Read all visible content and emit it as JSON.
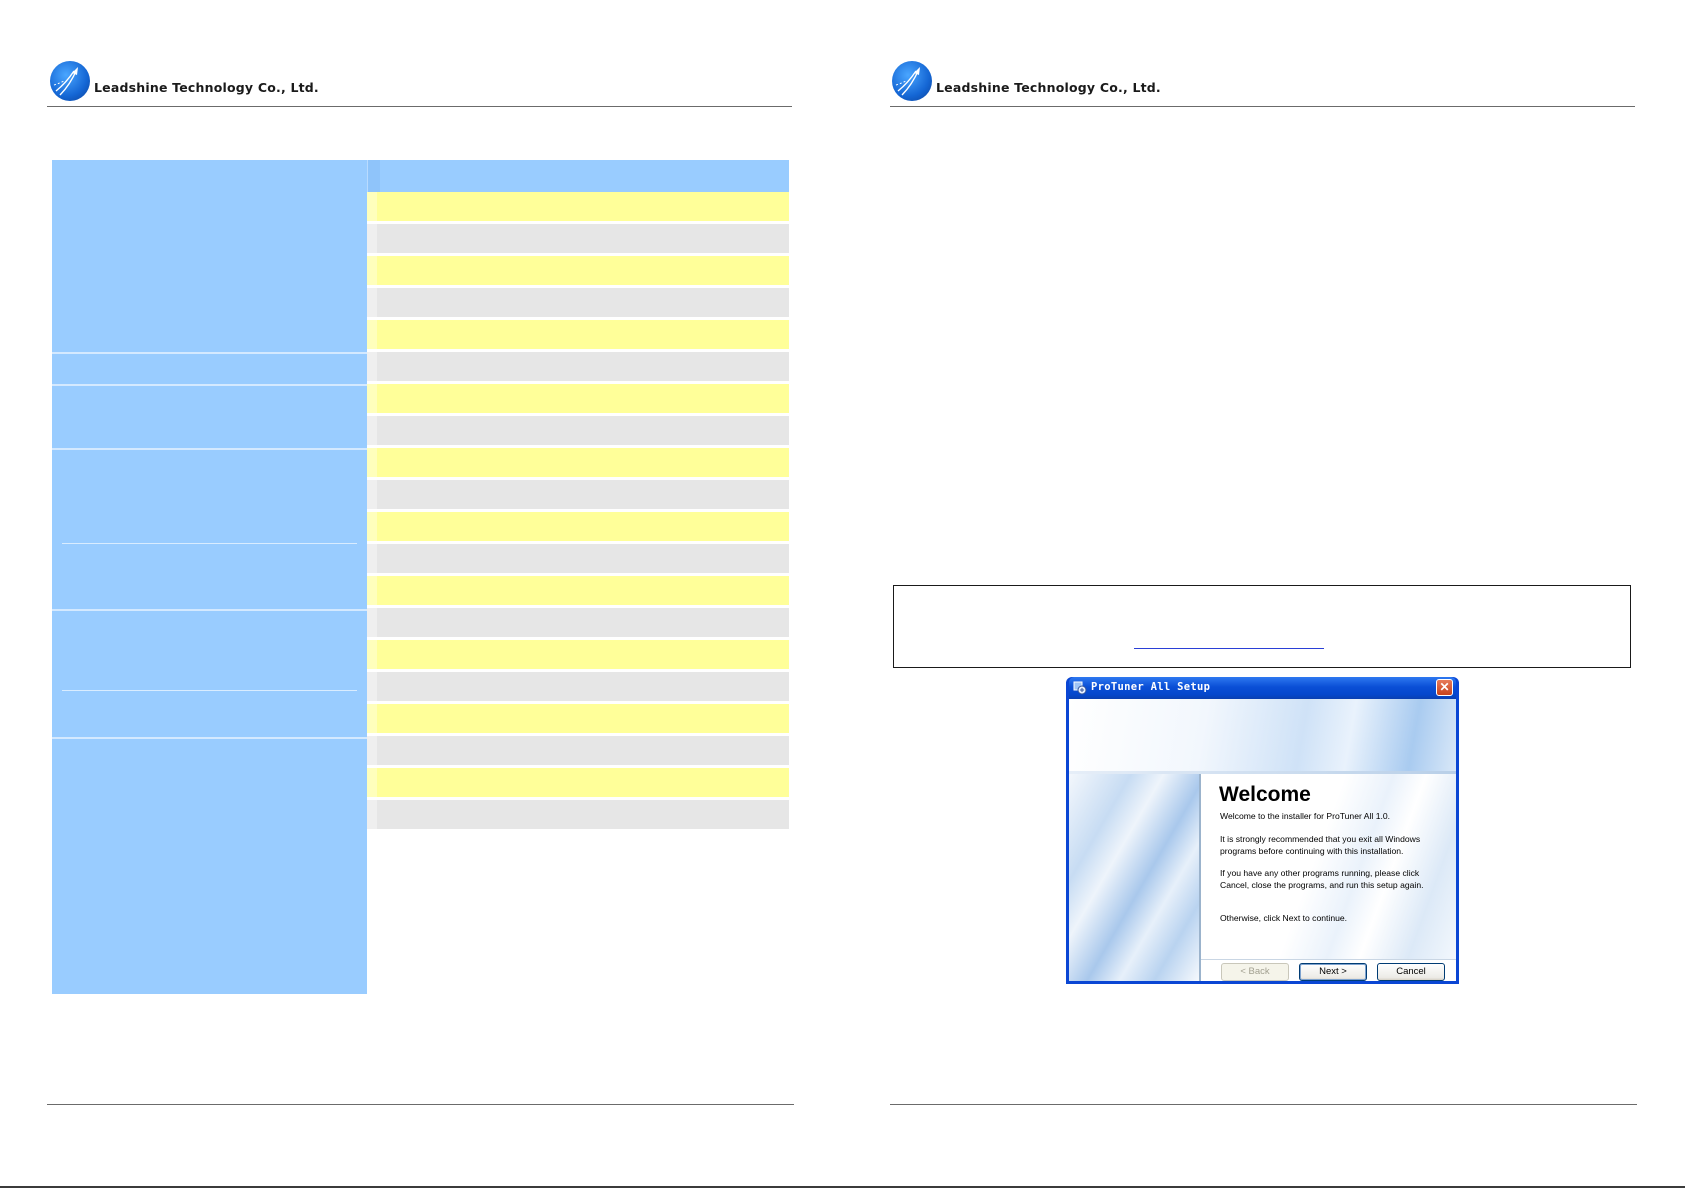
{
  "header": {
    "company_name": "Leadshine Technology Co., Ltd.",
    "logo_icon": "leadshine-logo-icon"
  },
  "colors": {
    "table_header_blue": "#99ccff",
    "row_yellow": "#ffff99",
    "row_gray": "#e6e6e6",
    "window_blue": "#0a46d4",
    "link_blue": "#2a3fd6"
  },
  "spec_table": {
    "right_row_colors": [
      "yellow",
      "gray",
      "yellow",
      "gray",
      "yellow",
      "gray",
      "yellow",
      "gray",
      "yellow",
      "gray",
      "yellow",
      "gray",
      "yellow",
      "gray",
      "yellow",
      "gray",
      "yellow",
      "gray",
      "yellow",
      "gray"
    ]
  },
  "installer": {
    "window_title": "ProTuner All Setup",
    "close_glyph": "✕",
    "heading": "Welcome",
    "paragraphs": [
      "Welcome to the installer for ProTuner All 1.0.",
      "It is strongly recommended that you exit all Windows programs before continuing with this installation.",
      "If you have any other programs running, please click Cancel, close the programs, and run this setup again.",
      "Otherwise, click Next to continue."
    ],
    "buttons": {
      "back": "< Back",
      "next": "Next >",
      "cancel": "Cancel"
    }
  }
}
